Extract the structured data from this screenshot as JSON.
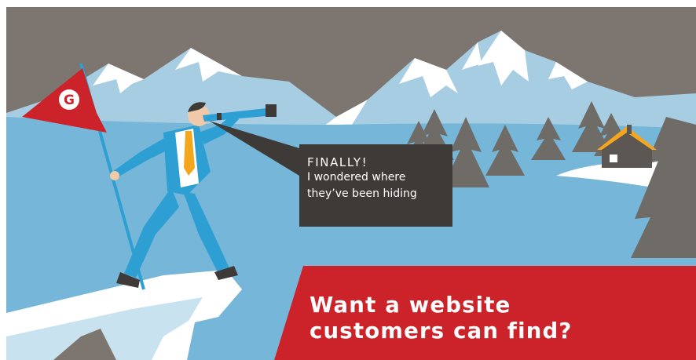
{
  "colors": {
    "sky": "#7d7570",
    "snow_field": "#76b6d9",
    "mountain_shadow": "#a7cde2",
    "snow": "#ffffff",
    "pine": "#6f6b67",
    "flag": "#cc2229",
    "suit": "#2e9fd3",
    "bubble": "#3e3a37",
    "cta": "#cc2229"
  },
  "flag": {
    "letter": "G"
  },
  "speech_bubble": {
    "title": "FINALLY!",
    "line1": "I wondered where",
    "line2": "they’ve been hiding"
  },
  "cta": {
    "line1": "Want a website",
    "line2": "customers can find?"
  }
}
